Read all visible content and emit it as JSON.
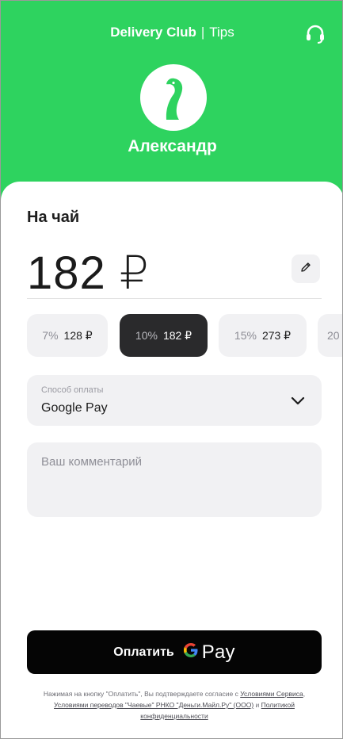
{
  "header": {
    "brand_name": "Delivery Club",
    "brand_sep": "|",
    "brand_suffix": "Tips",
    "support_icon": "headset-icon",
    "courier_name": "Александр",
    "avatar_icon": "goose-logo-icon"
  },
  "tip": {
    "title": "На чай",
    "amount": "182 ₽",
    "edit_icon": "pencil-icon"
  },
  "chips": [
    {
      "pct": "7%",
      "sum": "128 ₽",
      "active": false
    },
    {
      "pct": "10%",
      "sum": "182 ₽",
      "active": true
    },
    {
      "pct": "15%",
      "sum": "273 ₽",
      "active": false
    },
    {
      "pct": "20",
      "sum": "",
      "active": false
    }
  ],
  "payment": {
    "label": "Способ оплаты",
    "value": "Google Pay",
    "chevron_icon": "chevron-down-icon"
  },
  "comment": {
    "placeholder": "Ваш комментарий",
    "value": ""
  },
  "pay_button": {
    "label": "Оплатить",
    "gpay_word": "Pay"
  },
  "legal": {
    "prefix": "Нажимая на кнопку \"Оплатить\", Вы подтверждаете согласие с",
    "link1": "Условиями Сервиса",
    "comma": ",",
    "link2": "Условиями переводов \"Чаевые\" РНКО \"Деньги.Майл.Ру\" (ООО)",
    "and": "и",
    "link3": "Политикой конфиденциальности"
  },
  "colors": {
    "brand_green": "#2ed35f",
    "dark_chip": "#2a2a2c",
    "surface": "#f1f1f3",
    "pay_button": "#050505"
  }
}
